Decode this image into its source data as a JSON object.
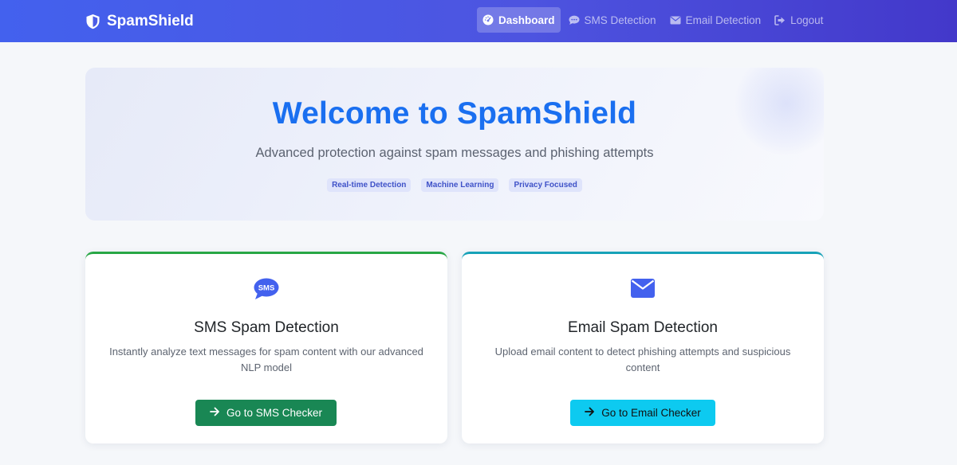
{
  "brand": {
    "name": "SpamShield"
  },
  "nav": {
    "items": [
      {
        "label": "Dashboard",
        "icon": "gauge-icon",
        "active": true
      },
      {
        "label": "SMS Detection",
        "icon": "chat-icon",
        "active": false
      },
      {
        "label": "Email Detection",
        "icon": "envelope-icon",
        "active": false
      },
      {
        "label": "Logout",
        "icon": "logout-icon",
        "active": false
      }
    ]
  },
  "hero": {
    "title": "Welcome to SpamShield",
    "subtitle": "Advanced protection against spam messages and phishing attempts",
    "badges": [
      "Real-time Detection",
      "Machine Learning",
      "Privacy Focused"
    ]
  },
  "cards": [
    {
      "icon": "sms-bubble-icon",
      "title": "SMS Spam Detection",
      "description": "Instantly analyze text messages for spam content with our advanced NLP model",
      "button": "Go to SMS Checker",
      "accent": "#28a745",
      "button_color": "#198754"
    },
    {
      "icon": "envelope-icon",
      "title": "Email Spam Detection",
      "description": "Upload email content to detect phishing attempts and suspicious content",
      "button": "Go to Email Checker",
      "accent": "#17a2b8",
      "button_color": "#0dcaf0"
    }
  ],
  "colors": {
    "navbar_start": "#4361ee",
    "navbar_end": "#4338ca",
    "hero_title": "#1a6ff0",
    "icon_blue": "#4361ee"
  }
}
